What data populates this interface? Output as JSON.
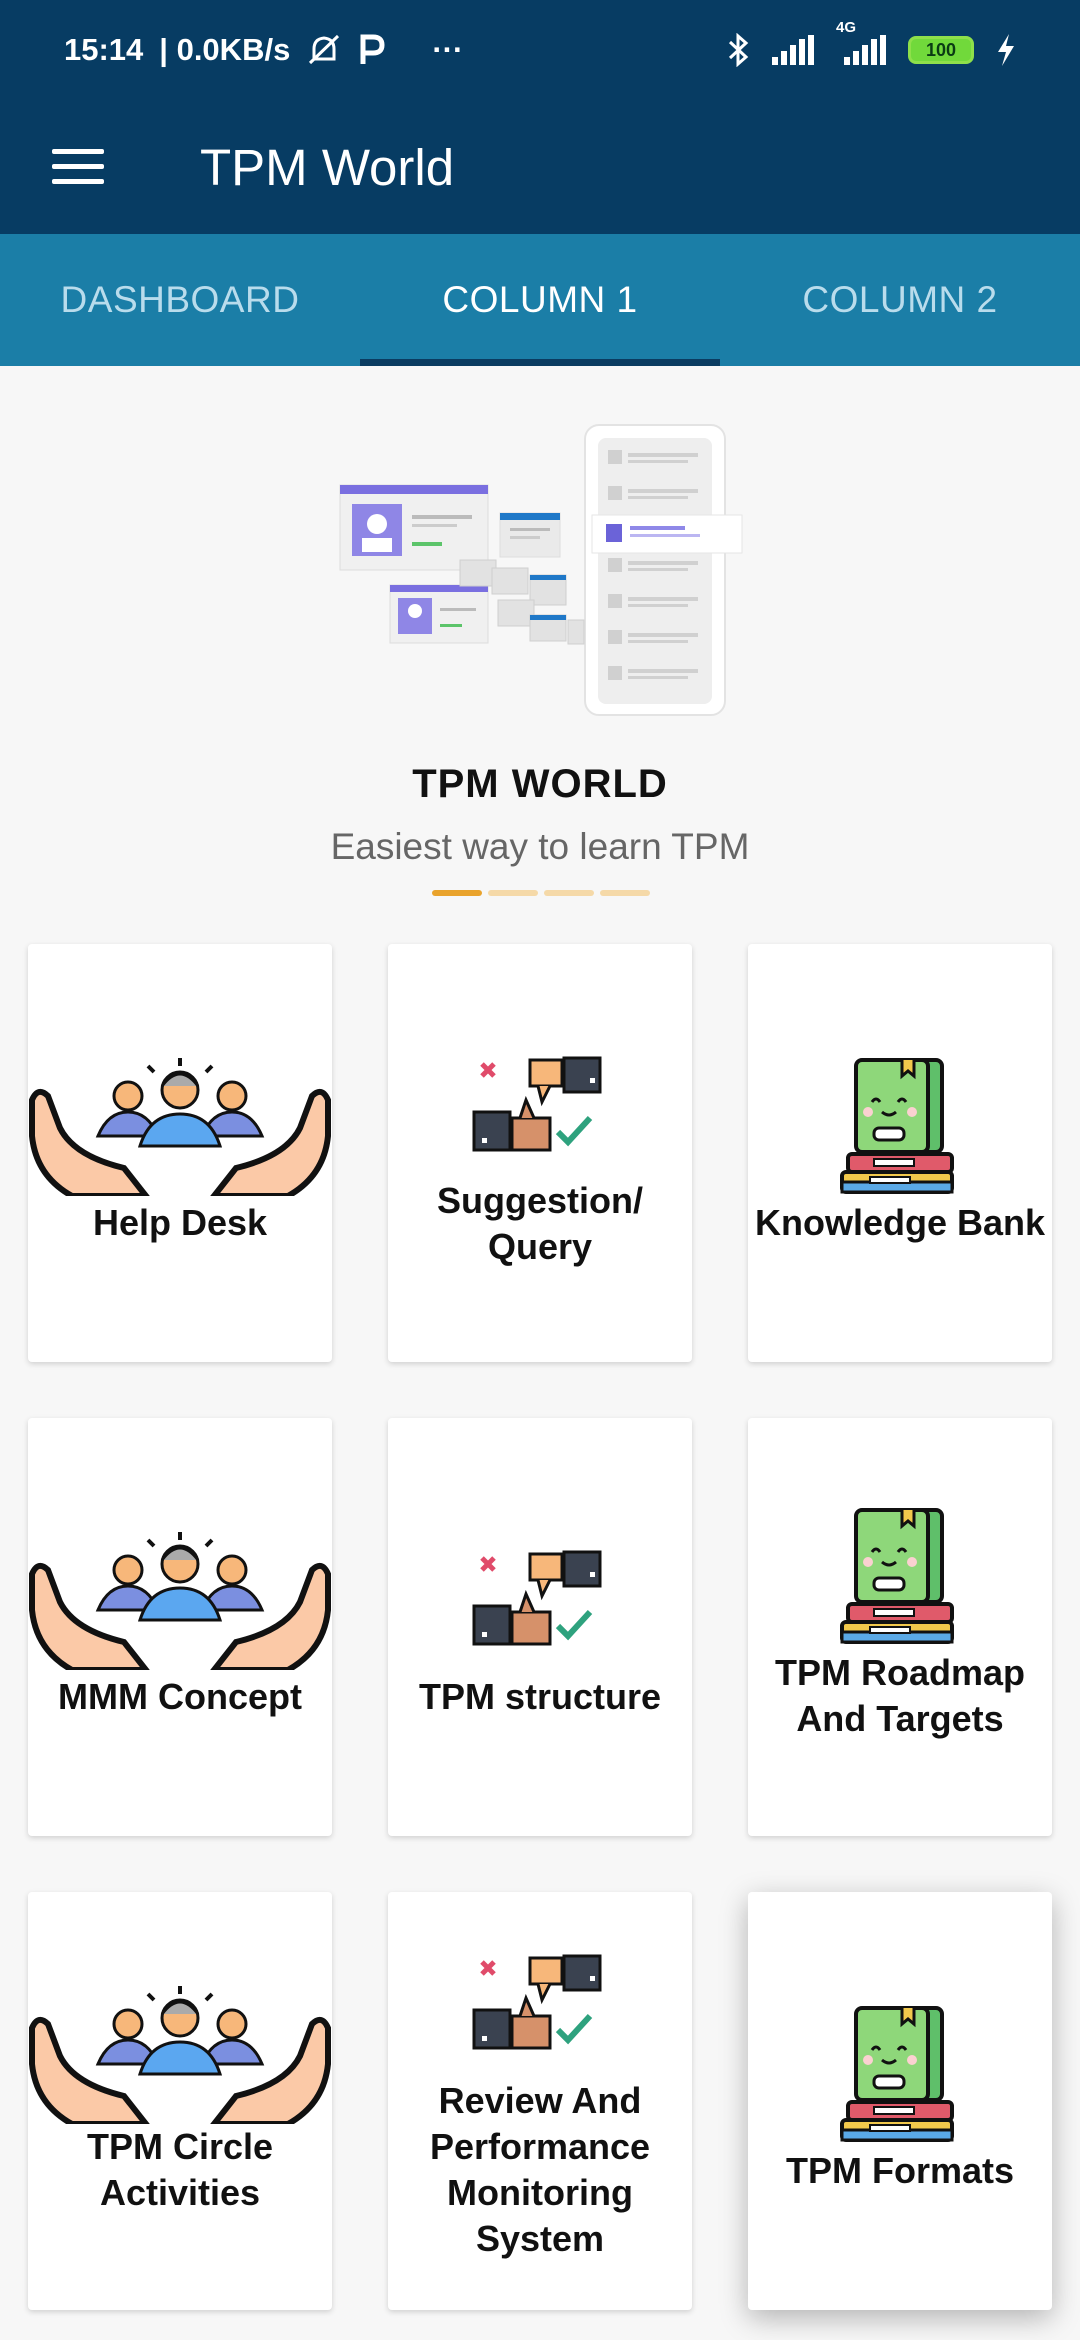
{
  "status": {
    "time": "15:14",
    "speed": "| 0.0KB/s",
    "battery": "100",
    "network": "4G"
  },
  "header": {
    "title": "TPM World"
  },
  "tabs": [
    {
      "label": "DASHBOARD"
    },
    {
      "label": "COLUMN 1"
    },
    {
      "label": "COLUMN 2"
    }
  ],
  "hero": {
    "title": "TPM WORLD",
    "subtitle": "Easiest way to learn TPM"
  },
  "cards": [
    {
      "label": "Help Desk",
      "icon": "team-hands-icon"
    },
    {
      "label": "Suggestion/ Query",
      "icon": "thumbs-feedback-icon"
    },
    {
      "label": "Knowledge Bank",
      "icon": "books-icon"
    },
    {
      "label": "MMM Concept",
      "icon": "team-hands-icon"
    },
    {
      "label": "TPM structure",
      "icon": "thumbs-feedback-icon"
    },
    {
      "label": "TPM Roadmap And Targets",
      "icon": "books-icon"
    },
    {
      "label": "TPM Circle Activities",
      "icon": "team-hands-icon"
    },
    {
      "label": "Review And Performance Monitoring System",
      "icon": "thumbs-feedback-icon"
    },
    {
      "label": "TPM Formats",
      "icon": "books-icon"
    }
  ],
  "colors": {
    "app_bar": "#073c63",
    "tab_bar": "#1b7ea7",
    "tab_indicator": "#0b3c61",
    "page_dot_active": "#e9a32c"
  }
}
